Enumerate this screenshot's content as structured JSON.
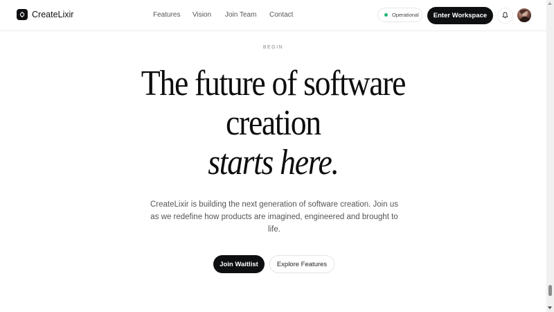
{
  "brand": {
    "name": "CreateLixir",
    "icon": "gear-logo-icon"
  },
  "nav": {
    "items": [
      {
        "label": "Features"
      },
      {
        "label": "Vision"
      },
      {
        "label": "Join Team"
      },
      {
        "label": "Contact"
      }
    ]
  },
  "header": {
    "status_label": "Operational",
    "status_color": "#22b573",
    "enter_label": "Enter Workspace",
    "bell_icon": "bell-icon",
    "avatar_icon": "user-avatar"
  },
  "hero": {
    "eyebrow": "BEGIN",
    "title_line1": "The future of software",
    "title_line2": "creation",
    "title_line3": "starts here.",
    "description": "CreateLixir is building the next generation of software creation. Join us as we redefine how products are imagined, engineered and brought to life.",
    "primary_cta": "Join Waitlist",
    "secondary_cta": "Explore Features"
  },
  "colors": {
    "accent": "#0e0f11",
    "background": "#ffffff"
  }
}
